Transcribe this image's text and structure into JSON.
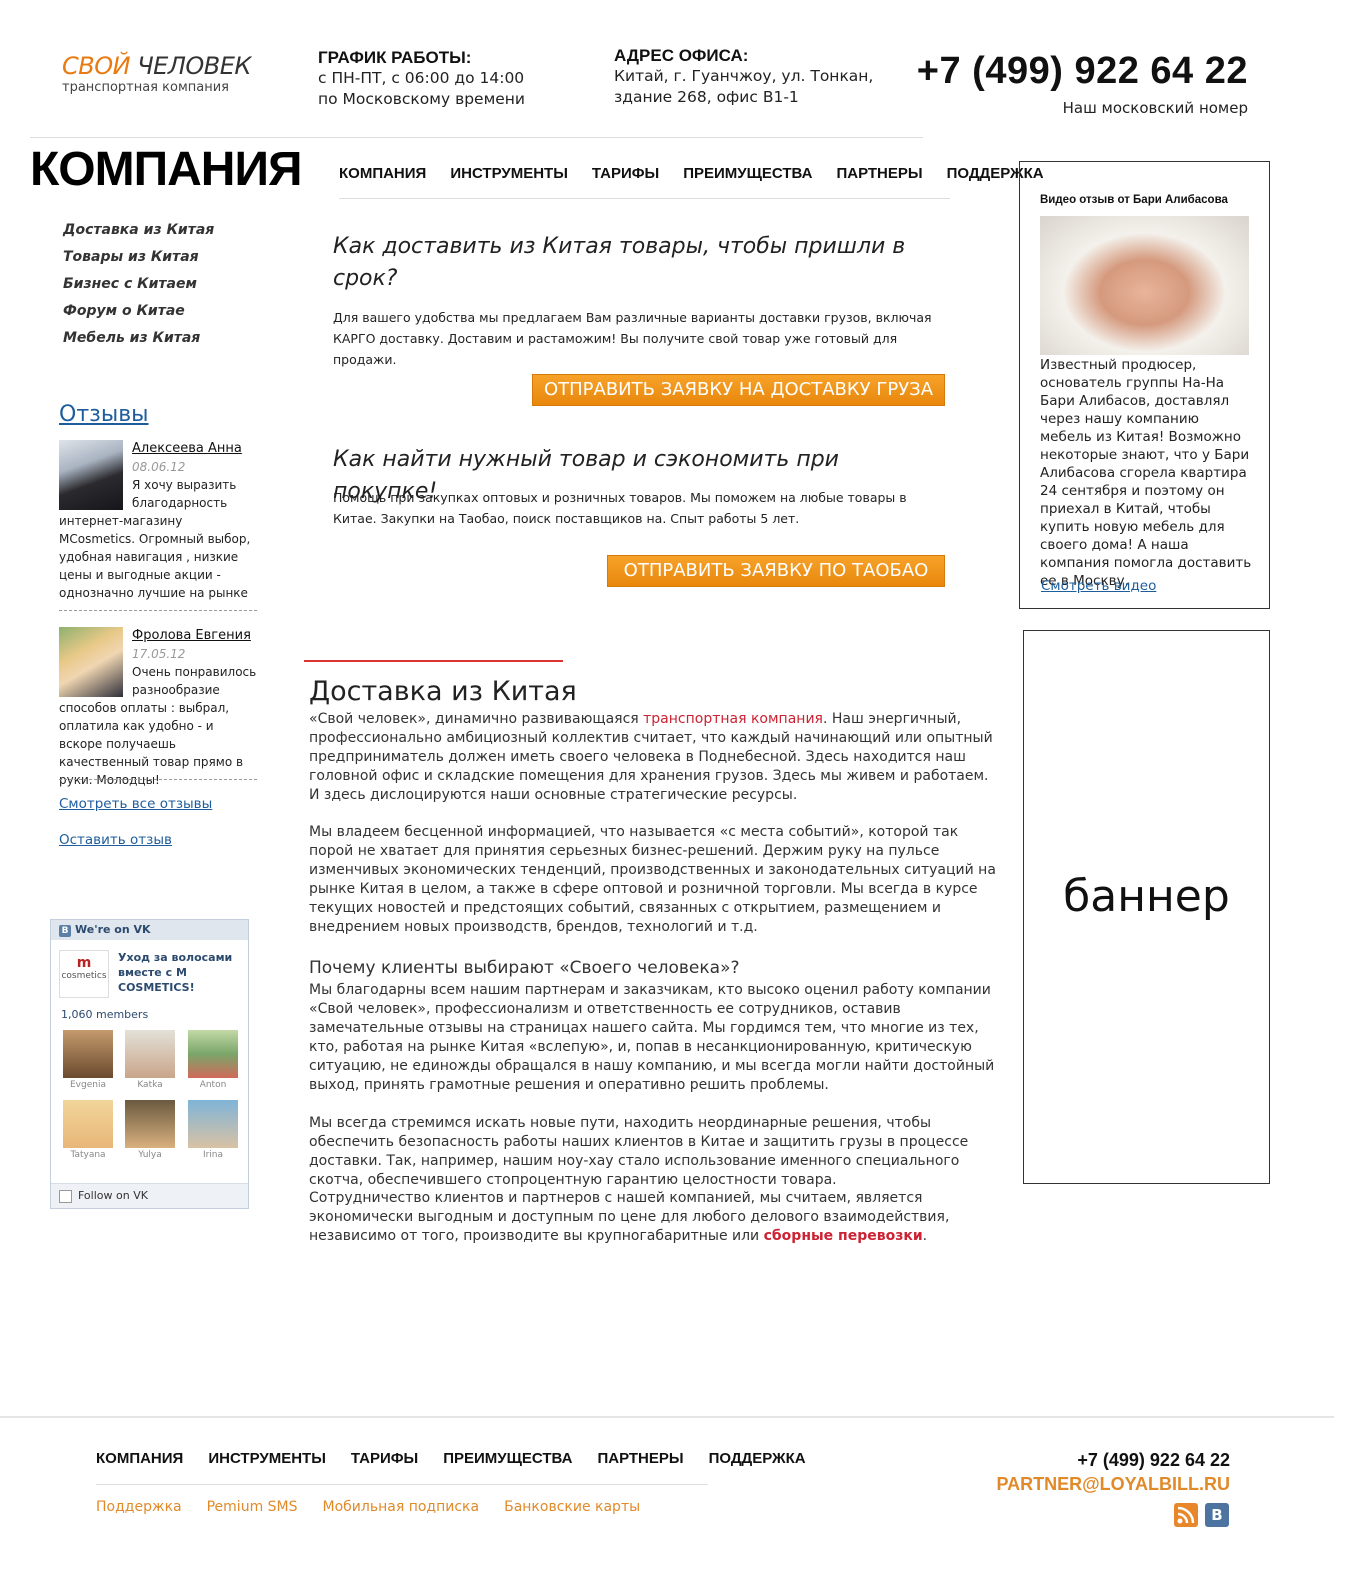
{
  "header": {
    "logo_word1": "СВОЙ",
    "logo_word2": "ЧЕЛОВЕК",
    "logo_sub": "транспортная компания",
    "schedule_title": "ГРАФИК РАБОТЫ:",
    "schedule_line1": "с ПН-ПТ, с 06:00 до 14:00",
    "schedule_line2": "по Московскому времени",
    "address_title": "АДРЕС ОФИСА:",
    "address_line1": "Китай, г. Гуанчжоу, ул. Тонкан,",
    "address_line2": "здание 268, офис В1-1",
    "phone": "+7 (499) 922 64 22",
    "phone_note": "Наш московский номер"
  },
  "page_title": "КОМПАНИЯ",
  "topnav": [
    "КОМПАНИЯ",
    "ИНСТРУМЕНТЫ",
    "ТАРИФЫ",
    "ПРЕИМУЩЕСТВА",
    "ПАРТНЕРЫ",
    "ПОДДЕРЖКА"
  ],
  "leftmenu": [
    "Доставка из Китая",
    "Товары из Китая",
    "Бизнес с Китаем",
    "Форум о Китае",
    "Мебель из Китая"
  ],
  "reviews": {
    "title": "Отзывы",
    "items": [
      {
        "name": "Алексеева Анна",
        "date": "08.06.12",
        "text": "Я хочу выразить благодарность интернет-магазину MCosmetics. Огромный выбор, удобная навигация , низкие цены и выгодные акции - однозначно лучшие на рынке"
      },
      {
        "name": "Фролова Евгения",
        "date": "17.05.12",
        "text": "Очень понравилось разнообразие способов оплаты : выбрал, оплатила как удобно - и вскоре получаешь качественный товар прямо в руки. Молодцы!"
      }
    ],
    "see_all": "Смотреть все отзывы",
    "leave": "Оставить отзыв"
  },
  "vk": {
    "head": "We're on VK",
    "b_letter": "B",
    "logo_mark": "m",
    "logo_word": "cosmetics",
    "group_name": "Уход за волосами вместе с M COSMETICS!",
    "members": "1,060 members",
    "people": [
      "Evgenia",
      "Katka",
      "Anton",
      "Tatyana",
      "Yulya",
      "Irina"
    ],
    "follow": "Follow on VK"
  },
  "main": {
    "q1_title": "Как доставить из Китая товары, чтобы пришли в срок?",
    "q1_text": "Для вашего удобства мы предлагаем Вам различные варианты доставки грузов, включая КАРГО доставку. Доставим и растаможим! Вы получите свой товар уже готовый для продажи.",
    "q1_button": "ОТПРАВИТЬ ЗАЯВКУ НА ДОСТАВКУ ГРУЗА",
    "q2_title": "Как найти нужный товар и сэкономить при покупке!",
    "q2_text": "Помощь при закупках оптовых и розничных товаров. Мы поможем на любые товары в Китае. Закупки на Таобао, поиск поставщиков на. Спыт работы 5 лет.",
    "q2_button": "ОТПРАВИТЬ ЗАЯВКУ ПО ТАОБАО",
    "section_title": "Доставка из Китая",
    "p1_a": "«Свой человек», динамично развивающаяся ",
    "p1_link": "транспортная компания",
    "p1_b": ". Наш энергичный, профессионально амбициозный коллектив считает, что каждый начинающий или опытный предприниматель должен иметь своего человека в Поднебесной. Здесь находится наш головной офис и складские помещения для хранения грузов. Здесь мы живем и работаем. И здесь дислоцируются наши основные стратегические ресурсы.",
    "p2": "Мы владеем бесценной информацией, что называется «с места событий», которой так порой не хватает для принятия серьезных бизнес-решений. Держим руку на пульсе изменчивых экономических тенденций, производственных и законодательных ситуаций на рынке Китая в целом, а также в сфере оптовой и розничной торговли. Мы всегда в курсе текущих новостей и предстоящих событий, связанных с открытием, размещением и внедрением новых производств, брендов, технологий и т.д.",
    "subtitle": "Почему клиенты выбирают «Своего человека»?",
    "p3": "Мы благодарны всем нашим партнерам и заказчикам, кто высоко оценил работу компании «Свой человек», профессионализм и ответственность ее сотрудников, оставив замечательные отзывы на страницах нашего сайта. Мы гордимся тем, что многие из тех, кто, работая на рынке Китая «вслепую», и, попав в несанкционированную, критическую ситуацию, не единожды обращался в нашу компанию, и мы всегда могли найти достойный выход, принять грамотные решения и оперативно решить проблемы.",
    "p4": "Мы всегда стремимся искать новые пути, находить неординарные решения, чтобы обеспечить безопасность работы наших клиентов в Китае и защитить грузы в процессе доставки. Так, например, нашим ноу-хау стало использование именного специального скотча, обеспечившего стопроцентную гарантию целостности товара.",
    "p5_a": "Сотрудничество клиентов и партнеров с нашей компанией, мы считаем, является экономически выгодным и доступным по цене для любого делового взаимодействия, независимо от того, производите вы крупногабаритные или ",
    "p5_link": "сборные перевозки",
    "p5_b": "."
  },
  "video": {
    "title": "Видео отзыв от Бари Алибасова",
    "text": "Известный продюсер, основатель группы На-На Бари Алибасов, доставлял через нашу компанию мебель из Китая! Возможно некоторые знают, что у Бари Алибасова сгорела квартира 24 сентября и поэтому он приехал в Китай, чтобы купить новую мебель для своего дома! А наша компания помогла доставить ее в Москву.",
    "link": "Смотреть видео"
  },
  "banner": "баннер",
  "footer": {
    "nav": [
      "КОМПАНИЯ",
      "ИНСТРУМЕНТЫ",
      "ТАРИФЫ",
      "ПРЕИМУЩЕСТВА",
      "ПАРТНЕРЫ",
      "ПОДДЕРЖКА"
    ],
    "sub": [
      "Поддержка",
      "Pemium SMS",
      "Мобильная подписка",
      "Банковские карты"
    ],
    "phone": "+7 (499) 922 64 22",
    "email": "PARTNER@LOYALBILL.RU",
    "vk_letter": "B"
  },
  "colors": {
    "accent_orange": "#e8870c",
    "link_blue": "#1d5d9b",
    "red": "#cc2233"
  }
}
